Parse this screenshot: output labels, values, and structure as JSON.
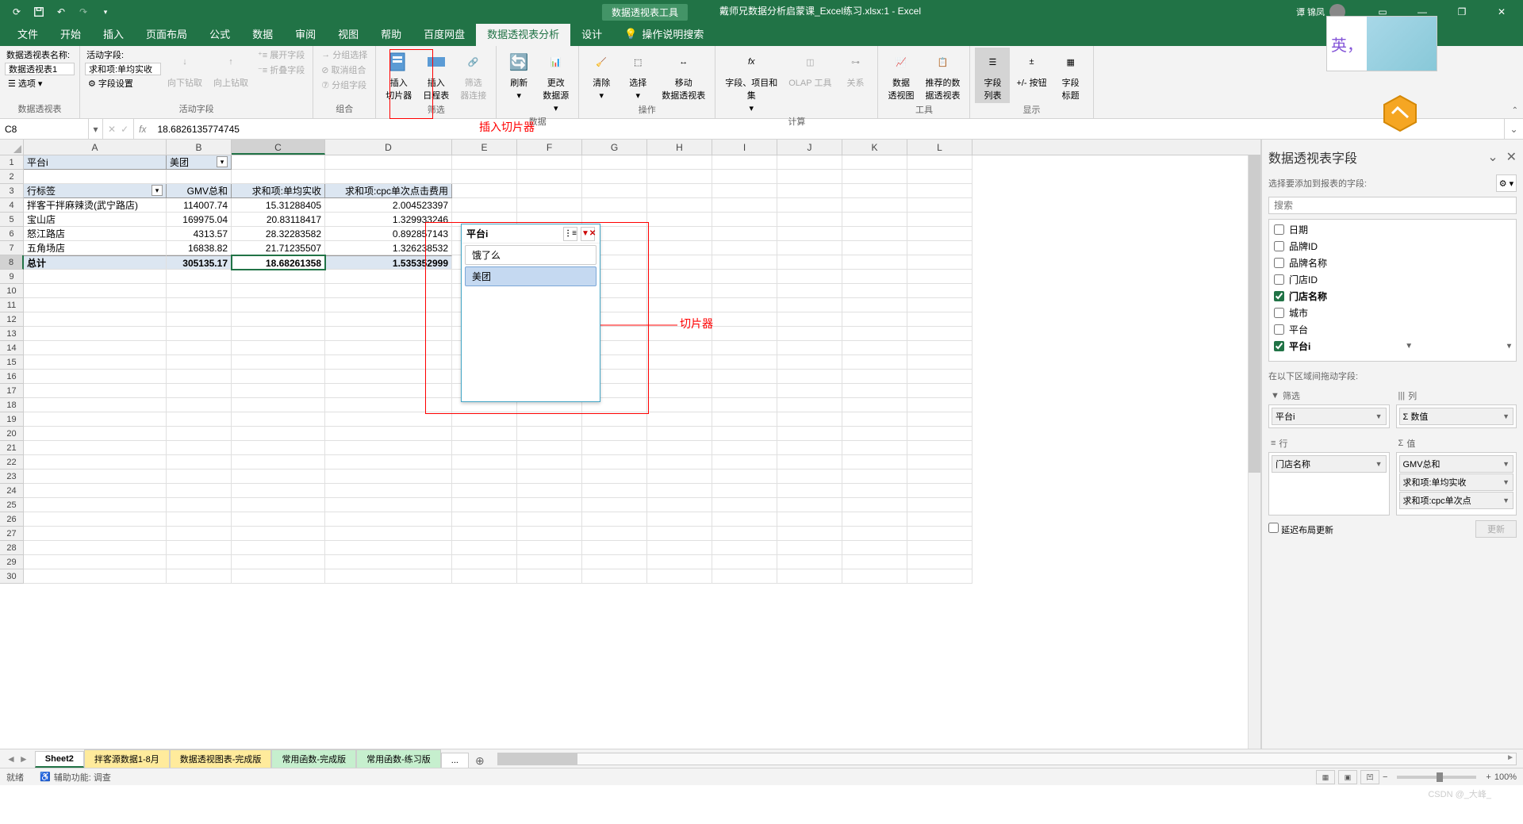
{
  "title_bar": {
    "tools_tab": "数据透视表工具",
    "filename": "戴师兄数据分析启蒙课_Excel练习.xlsx:1 - Excel",
    "user": "谭 锦凤"
  },
  "tabs": [
    "文件",
    "开始",
    "插入",
    "页面布局",
    "公式",
    "数据",
    "审阅",
    "视图",
    "帮助",
    "百度网盘",
    "数据透视表分析",
    "设计"
  ],
  "tell_me": "操作说明搜索",
  "ribbon": {
    "pivot_name_label": "数据透视表名称:",
    "pivot_name": "数据透视表1",
    "options_btn": "选项",
    "group1": "数据透视表",
    "active_field_label": "活动字段:",
    "active_field": "求和项:单均实收",
    "field_settings": "字段设置",
    "drill_down": "向下钻取",
    "drill_up": "向上钻取",
    "expand_field": "展开字段",
    "collapse_field": "折叠字段",
    "group2": "活动字段",
    "group_sel": "分组选择",
    "ungroup": "取消组合",
    "group_field": "分组字段",
    "group3": "组合",
    "insert_slicer": "插入\n切片器",
    "insert_timeline": "插入\n日程表",
    "filter_conn": "筛选\n器连接",
    "group4": "筛选",
    "refresh": "刷新",
    "change_data": "更改\n数据源",
    "group5": "数据",
    "clear": "清除",
    "select": "选择",
    "move_pivot": "移动\n数据透视表",
    "group6": "操作",
    "fields_items": "字段、项目和\n集",
    "olap": "OLAP 工具",
    "relations": "关系",
    "group7": "计算",
    "pivot_chart": "数据\n透视图",
    "recommended": "推荐的数\n据透视表",
    "group8": "工具",
    "field_list": "字段\n列表",
    "buttons": "+/- 按钮",
    "field_headers": "字段\n标题",
    "group9": "显示"
  },
  "annotations": {
    "insert_slicer": "插入切片器",
    "slicer": "切片器"
  },
  "name_box": "C8",
  "formula": "18.6826135774745",
  "columns": [
    "A",
    "B",
    "C",
    "D",
    "E",
    "F",
    "G",
    "H",
    "I",
    "J",
    "K",
    "L"
  ],
  "pivot": {
    "filter_field": "平台i",
    "filter_value": "美团",
    "row_label": "行标签",
    "cols": [
      "GMV总和",
      "求和项:单均实收",
      "求和项:cpc单次点击费用"
    ],
    "rows": [
      {
        "label": "拌客干拌麻辣烫(武宁路店)",
        "v": [
          "114007.74",
          "15.31288405",
          "2.004523397"
        ]
      },
      {
        "label": "宝山店",
        "v": [
          "169975.04",
          "20.83118417",
          "1.329933246"
        ]
      },
      {
        "label": "怒江路店",
        "v": [
          "4313.57",
          "28.32283582",
          "0.892857143"
        ]
      },
      {
        "label": "五角场店",
        "v": [
          "16838.82",
          "21.71235507",
          "1.326238532"
        ]
      }
    ],
    "total_label": "总计",
    "totals": [
      "305135.17",
      "18.68261358",
      "1.535352999"
    ]
  },
  "slicer": {
    "title": "平台i",
    "items": [
      "饿了么",
      "美团"
    ],
    "selected": 1
  },
  "field_panel": {
    "title": "数据透视表字段",
    "subtitle": "选择要添加到报表的字段:",
    "search_placeholder": "搜索",
    "fields": [
      {
        "name": "日期",
        "checked": false
      },
      {
        "name": "品牌ID",
        "checked": false
      },
      {
        "name": "品牌名称",
        "checked": false
      },
      {
        "name": "门店ID",
        "checked": false
      },
      {
        "name": "门店名称",
        "checked": true
      },
      {
        "name": "城市",
        "checked": false
      },
      {
        "name": "平台",
        "checked": false
      },
      {
        "name": "平台i",
        "checked": true,
        "filtered": true
      }
    ],
    "areas_label": "在以下区域间拖动字段:",
    "area_filter": "筛选",
    "area_cols": "列",
    "area_rows": "行",
    "area_vals": "值",
    "filter_items": [
      "平台i"
    ],
    "col_items": [
      "Σ 数值"
    ],
    "row_items": [
      "门店名称"
    ],
    "val_items": [
      "GMV总和",
      "求和项:单均实收",
      "求和项:cpc单次点"
    ],
    "defer": "延迟布局更新",
    "update": "更新"
  },
  "sheets": {
    "tabs": [
      "Sheet2",
      "拌客源数据1-8月",
      "数据透视图表-完成版",
      "常用函数-完成版",
      "常用函数-练习版"
    ],
    "active": 0,
    "more": "..."
  },
  "status": {
    "ready": "就绪",
    "access": "辅助功能: 调查",
    "zoom": "100%"
  },
  "ime": "英，",
  "watermark": "CSDN @_大峰_"
}
